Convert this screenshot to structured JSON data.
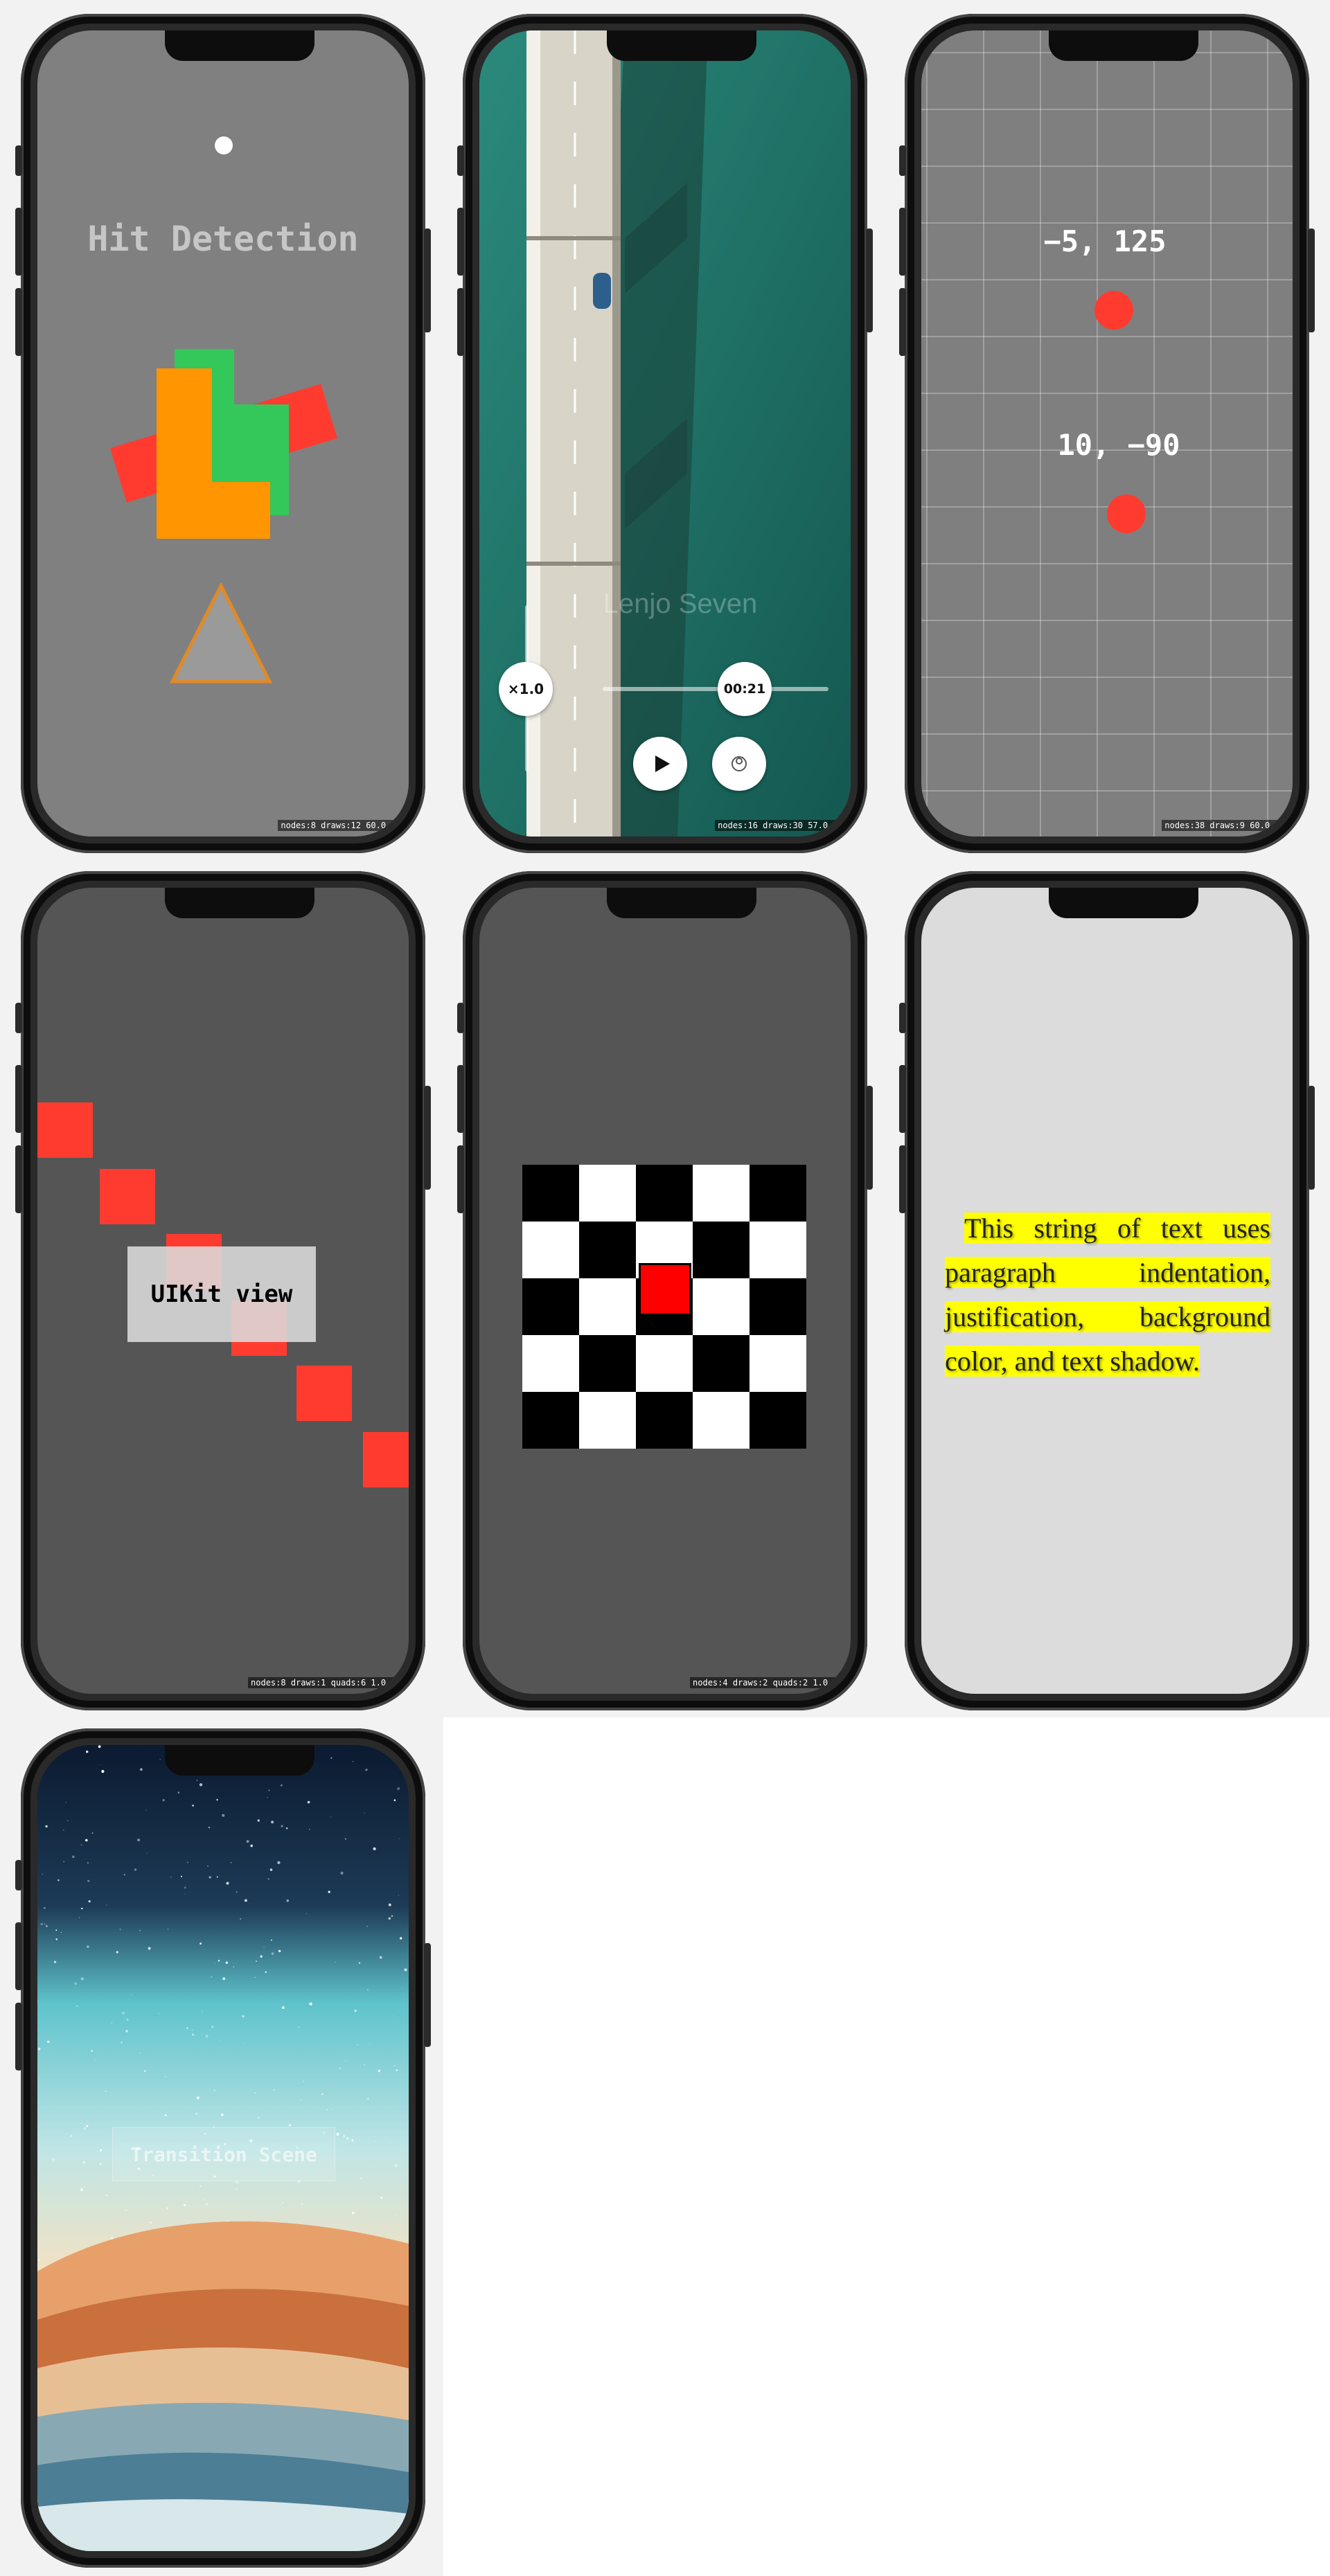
{
  "colors": {
    "page_background": "#f2f2f2",
    "phone_frame": "#2a2a2a",
    "node_red": "#ff3b30",
    "node_orange": "#ff9500",
    "node_green": "#34c759",
    "highlight_yellow": "#ffff00"
  },
  "screens": {
    "hit_detection": {
      "title": "Hit Detection",
      "stats": "nodes:8 draws:12  60.0 fps"
    },
    "video": {
      "watermark": "Lenjo Seven",
      "rate": "×1.0",
      "time": "00:21",
      "play_icon": "play-icon",
      "pip_icon": "picture-in-picture-icon",
      "stats": "nodes:16 draws:30  57.0 fps"
    },
    "coordinates": {
      "label_top": "−5, 125",
      "label_bottom": "10, −90",
      "stats": "nodes:38 draws:9  60.0 fps"
    },
    "uikit": {
      "label": "UIKit view",
      "stats": "nodes:8 draws:1 quads:6  1.0 fps"
    },
    "checkerboard": {
      "stats": "nodes:4 draws:2 quads:2  1.0 fps"
    },
    "paragraph": {
      "text": "This string of text uses paragraph indentation, justification, background color, and text shadow."
    },
    "transition": {
      "button": "Transition Scene"
    }
  }
}
